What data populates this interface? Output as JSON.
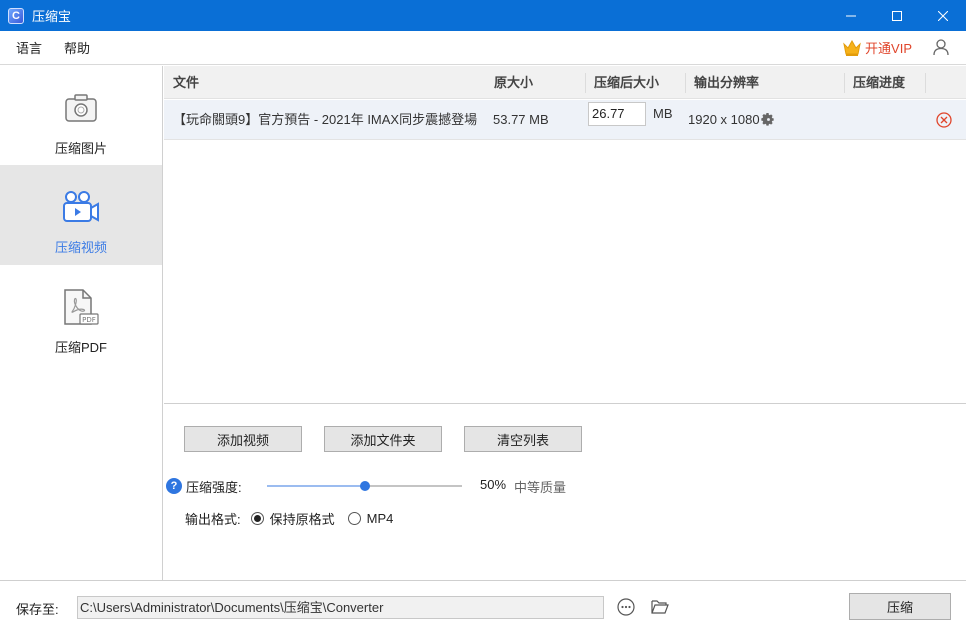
{
  "app": {
    "title": "压缩宝",
    "logo_letter": "C"
  },
  "menu": {
    "items": [
      "语言",
      "帮助"
    ],
    "vip_label": "开通VIP"
  },
  "sidebar": {
    "items": [
      {
        "label": "压缩图片",
        "icon": "camera-icon",
        "active": false
      },
      {
        "label": "压缩视频",
        "icon": "video-camera-icon",
        "active": true
      },
      {
        "label": "压缩PDF",
        "icon": "pdf-file-icon",
        "active": false
      }
    ]
  },
  "table": {
    "columns": [
      "文件",
      "原大小",
      "压缩后大小",
      "输出分辨率",
      "压缩进度"
    ],
    "rows": [
      {
        "file": "【玩命關頭9】官方預告 - 2021年 IMAX同步震撼登場....",
        "original_size": "53.77 MB",
        "compressed_size": "26.77",
        "compressed_unit": "MB",
        "resolution": "1920 x 1080",
        "progress": ""
      }
    ]
  },
  "actions": {
    "add_video": "添加视频",
    "add_folder": "添加文件夹",
    "clear_list": "清空列表"
  },
  "strength": {
    "label": "压缩强度:",
    "value_percent": 50,
    "value_text": "50%",
    "quality_text": "中等质量"
  },
  "format": {
    "label": "输出格式:",
    "options": [
      "保持原格式",
      "MP4"
    ],
    "selected": "保持原格式"
  },
  "save": {
    "label": "保存至:",
    "path": "C:\\Users\\Administrator\\Documents\\压缩宝\\Converter",
    "compress_button": "压缩"
  },
  "colors": {
    "titlebar": "#0a6fd6",
    "accent": "#2f76e0",
    "vip": "#e0452b",
    "remove": "#e0452b"
  }
}
